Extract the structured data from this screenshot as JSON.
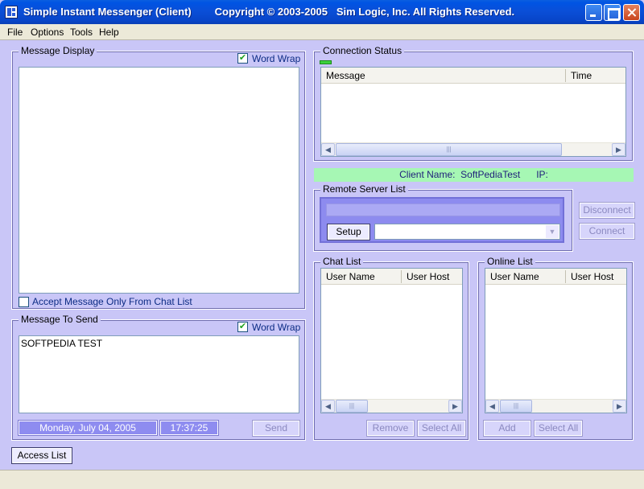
{
  "window": {
    "title": "Simple Instant Messenger (Client)        Copyright © 2003-2005   Sim Logic, Inc. All Rights Reserved."
  },
  "menu": [
    "File",
    "Options",
    "Tools",
    "Help"
  ],
  "message_display": {
    "title": "Message Display",
    "word_wrap_label": "Word Wrap",
    "accept_label": "Accept Message Only From Chat List"
  },
  "message_to_send": {
    "title": "Message To Send",
    "word_wrap_label": "Word Wrap",
    "text": "SOFTPEDIA TEST",
    "date": "Monday, July 04, 2005",
    "time": "17:37:25",
    "send_label": "Send"
  },
  "connection_status": {
    "title": "Connection Status",
    "columns": [
      "Message",
      "Time"
    ]
  },
  "client_info": "Client Name:  SoftPediaTest      IP:",
  "remote_server": {
    "title": "Remote Server List",
    "setup_label": "Setup"
  },
  "connection_buttons": {
    "disconnect": "Disconnect",
    "connect": "Connect"
  },
  "chat_list": {
    "title": "Chat List",
    "columns": [
      "User Name",
      "User Host"
    ],
    "remove_label": "Remove",
    "select_all_label": "Select All"
  },
  "online_list": {
    "title": "Online List",
    "columns": [
      "User Name",
      "User Host"
    ],
    "add_label": "Add",
    "select_all_label": "Select All"
  },
  "access_list_label": "Access List",
  "colors": {
    "background": "#c9c6f7",
    "title_bar": "#0054e3",
    "client_info_bar": "#a6f7b4",
    "date_box": "#8e8cf0",
    "server_panel": "#8d8bef"
  }
}
